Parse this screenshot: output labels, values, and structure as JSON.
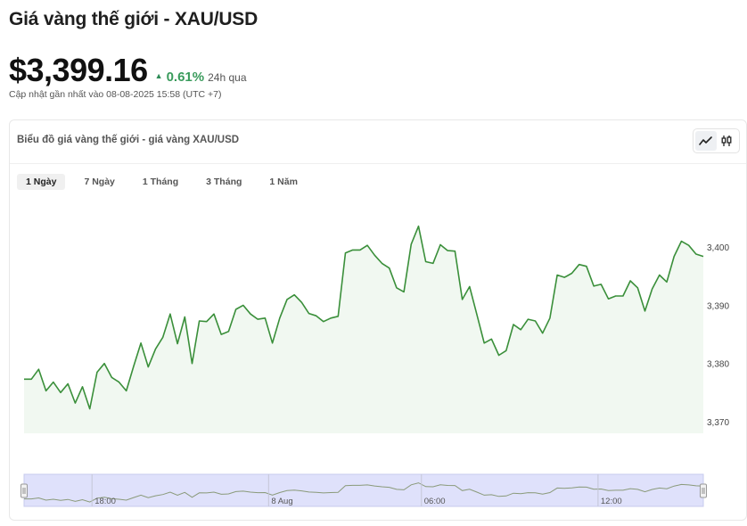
{
  "page": {
    "title": "Giá vàng thế giới - XAU/USD",
    "price": "$3,399.16",
    "change_pct": "0.61%",
    "change_direction": "up",
    "change_period": "24h qua",
    "updated": "Cập nhật gần nhất vào 08-08-2025 15:58 (UTC +7)",
    "up_color": "#3a9b5c"
  },
  "card": {
    "title": "Biểu đồ giá vàng thế giới - giá vàng XAU/USD",
    "view_buttons": [
      {
        "icon": "line-chart-icon",
        "active": true
      },
      {
        "icon": "candlestick-icon",
        "active": false
      }
    ],
    "ranges": [
      {
        "label": "1 Ngày",
        "active": true
      },
      {
        "label": "7 Ngày",
        "active": false
      },
      {
        "label": "1 Tháng",
        "active": false
      },
      {
        "label": "3 Tháng",
        "active": false
      },
      {
        "label": "1 Năm",
        "active": false
      }
    ]
  },
  "chart_data": {
    "type": "area",
    "title": "",
    "xlabel": "",
    "ylabel": "",
    "ylim": [
      3368,
      3406
    ],
    "y_ticks": [
      3370,
      3380,
      3390,
      3400
    ],
    "y_tick_labels": [
      "3,370",
      "3,380",
      "3,390",
      "3,400"
    ],
    "line_color": "#3a8f3a",
    "fill_color": "#f1f8f1",
    "grid": false,
    "navigator": {
      "tick_labels": [
        "18:00",
        "8 Aug",
        "06:00",
        "12:00"
      ],
      "tick_positions": [
        0.1,
        0.36,
        0.585,
        0.845
      ],
      "selection": "full"
    },
    "values": [
      3377.3,
      3377.3,
      3379.0,
      3375.3,
      3376.8,
      3375.0,
      3376.5,
      3373.2,
      3376.0,
      3372.2,
      3378.5,
      3380.0,
      3377.6,
      3376.8,
      3375.3,
      3379.5,
      3383.5,
      3379.4,
      3382.5,
      3384.5,
      3388.5,
      3383.4,
      3388.0,
      3380.0,
      3387.3,
      3387.2,
      3388.5,
      3385.0,
      3385.5,
      3389.3,
      3390.0,
      3388.5,
      3387.6,
      3387.8,
      3383.5,
      3387.8,
      3391.0,
      3391.8,
      3390.5,
      3388.6,
      3388.2,
      3387.2,
      3387.8,
      3388.1,
      3399.0,
      3399.5,
      3399.5,
      3400.3,
      3398.6,
      3397.2,
      3396.4,
      3393.0,
      3392.3,
      3400.5,
      3403.6,
      3397.5,
      3397.2,
      3400.4,
      3399.4,
      3399.3,
      3391.0,
      3393.2,
      3388.4,
      3383.5,
      3384.2,
      3381.4,
      3382.2,
      3386.7,
      3385.8,
      3387.6,
      3387.3,
      3385.2,
      3387.8,
      3395.2,
      3394.8,
      3395.5,
      3397.0,
      3396.7,
      3393.3,
      3393.6,
      3391.1,
      3391.6,
      3391.6,
      3394.2,
      3393.0,
      3389.0,
      3392.8,
      3395.2,
      3394.0,
      3398.4,
      3401.0,
      3400.3,
      3398.8,
      3398.4
    ]
  }
}
